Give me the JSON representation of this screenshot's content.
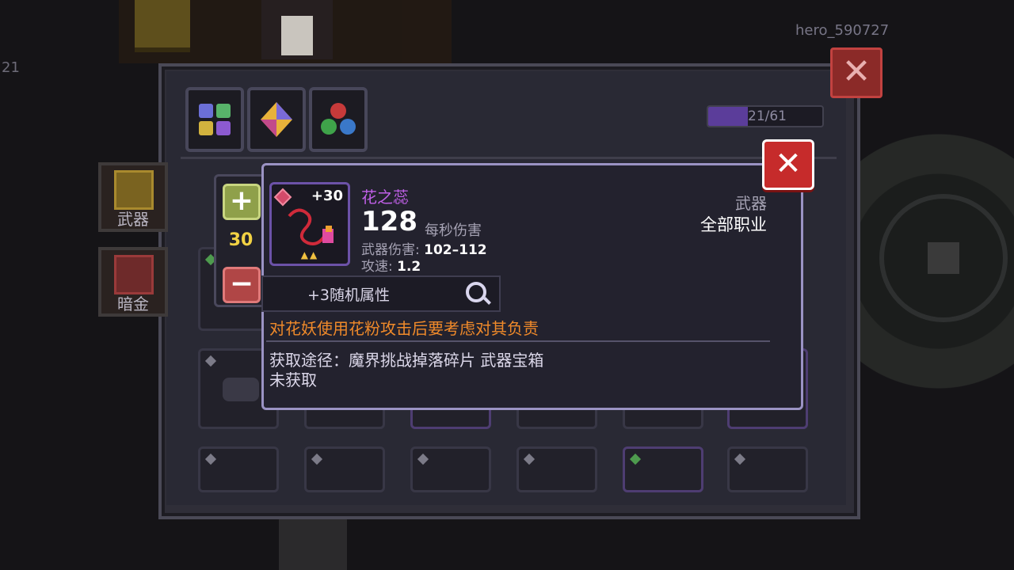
{
  "hud": {
    "player_name": "hero_590727",
    "left_counter": "21"
  },
  "panel": {
    "close_icon": "close-icon",
    "category_tabs": [
      {
        "icon": "grid-icon"
      },
      {
        "icon": "crystal-icon"
      },
      {
        "icon": "orbs-icon"
      }
    ],
    "progress": {
      "text": "21/61",
      "current": 21,
      "total": 61
    },
    "side_tabs": [
      {
        "label": "武器",
        "icon": "weapon-tab-icon"
      },
      {
        "label": "暗金",
        "icon": "dark-gold-tab-icon"
      }
    ]
  },
  "stepper": {
    "value": "30"
  },
  "item": {
    "name": "花之蕊",
    "level_badge": "+30",
    "dps": "128",
    "dps_label": "每秒伤害",
    "weapon_damage_label": "武器伤害:",
    "weapon_damage_value": "102–112",
    "attack_speed_label": "攻速:",
    "attack_speed_value": "1.2",
    "type": "武器",
    "class": "全部职业",
    "random_attr": "+3随机属性",
    "flavor": "对花妖使用花粉攻击后要考虑对其负责",
    "source": "获取途径：魔界挑战掉落碎片 武器宝箱",
    "status": "未获取"
  },
  "colors": {
    "item_name": "#c060e8",
    "flavor": "#f08a2a",
    "close_red": "#c62b2b",
    "stepper_value": "#f2d244"
  }
}
